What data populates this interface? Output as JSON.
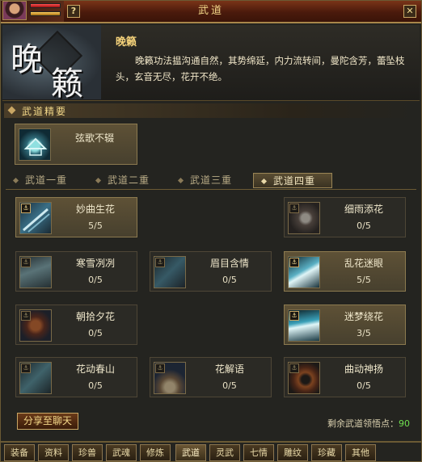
{
  "window": {
    "title": "武道",
    "help_label": "?",
    "close_label": "✕"
  },
  "header": {
    "art_chars": [
      "晚",
      "籁"
    ],
    "skill_name": "晚籁",
    "description": "晚籁功法揾沟通自然，其势绵延，内力流转间，曼陀含芳，蕾坠枝头，玄音无尽，花开不绝。"
  },
  "essentials": {
    "heading": "武道精要",
    "slot": {
      "name": "弦歌不辍",
      "icon": "pavilion-icon"
    }
  },
  "tabs": [
    {
      "label": "武道一重",
      "active": false
    },
    {
      "label": "武道二重",
      "active": false
    },
    {
      "label": "武道三重",
      "active": false
    },
    {
      "label": "武道四重",
      "active": true
    }
  ],
  "skills": [
    {
      "name": "妙曲生花",
      "level": "5/5",
      "active": true,
      "icon": "flute-icon"
    },
    {
      "name": "细雨添花",
      "level": "0/5",
      "active": false,
      "icon": "petal-icon"
    },
    {
      "name": "寒雪冽冽",
      "level": "0/5",
      "active": false,
      "icon": "snow-icon"
    },
    {
      "name": "眉目含情",
      "level": "0/5",
      "active": false,
      "icon": "hand-icon"
    },
    {
      "name": "乱花迷眼",
      "level": "5/5",
      "active": true,
      "icon": "sleeve-icon"
    },
    {
      "name": "朝拾夕花",
      "level": "0/5",
      "active": false,
      "icon": "flower-icon"
    },
    {
      "name": "迷梦绕花",
      "level": "3/5",
      "active": true,
      "icon": "wave-icon"
    },
    {
      "name": "花动春山",
      "level": "0/5",
      "active": false,
      "icon": "mist-icon"
    },
    {
      "name": "花解语",
      "level": "0/5",
      "active": false,
      "icon": "fan-icon"
    },
    {
      "name": "曲动神扬",
      "level": "0/5",
      "active": false,
      "icon": "vortex-icon"
    }
  ],
  "skill_tag": "⚓",
  "footer": {
    "share_label": "分享至聊天",
    "remaining_label": "剩余武道领悟点：",
    "remaining_points": "90"
  },
  "bottom_tabs": [
    {
      "label": "装备",
      "active": false
    },
    {
      "label": "资料",
      "active": false
    },
    {
      "label": "珍兽",
      "active": false
    },
    {
      "label": "武魂",
      "active": false
    },
    {
      "label": "修炼",
      "active": false
    },
    {
      "label": "武道",
      "active": true
    },
    {
      "label": "灵武",
      "active": false
    },
    {
      "label": "七情",
      "active": false
    },
    {
      "label": "雕纹",
      "active": false
    },
    {
      "label": "珍藏",
      "active": false
    },
    {
      "label": "其他",
      "active": false
    }
  ]
}
